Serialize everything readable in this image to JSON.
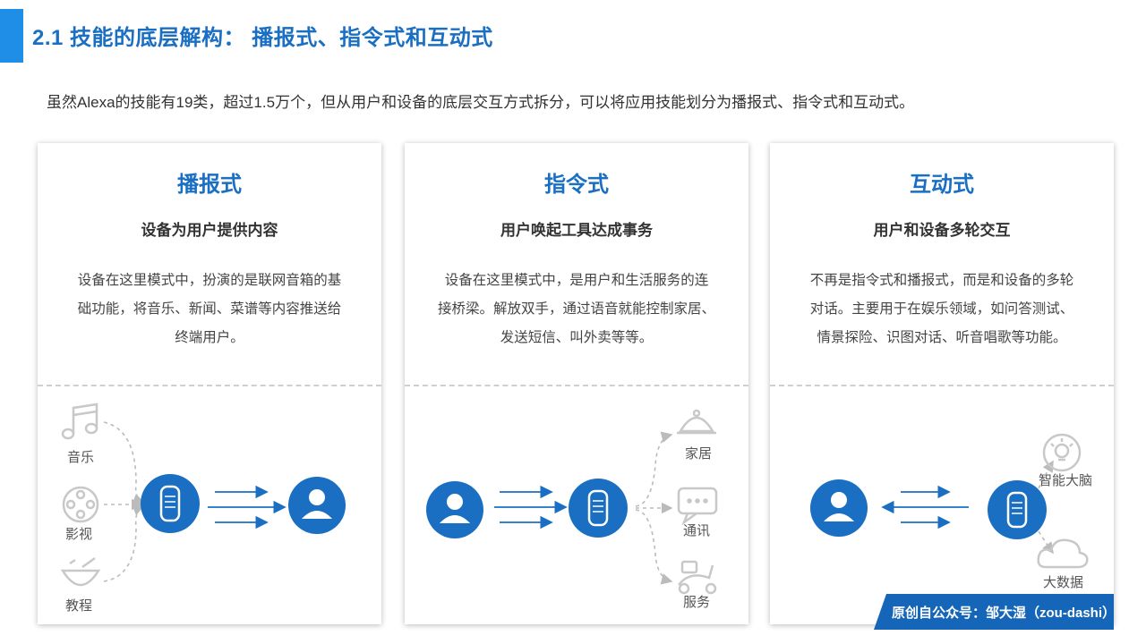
{
  "header": {
    "title": "2.1 技能的底层解构： 播报式、指令式和互动式",
    "intro": "虽然Alexa的技能有19类，超过1.5万个，但从用户和设备的底层交互方式拆分，可以将应用技能划分为播报式、指令式和互动式。"
  },
  "cards": [
    {
      "title": "播报式",
      "subtitle": "设备为用户提供内容",
      "desc_lines": [
        "设备在这里模式中，扮演的是联网音箱的基",
        "础功能，将音乐、新闻、菜谱等内容推送给",
        "终端用户。"
      ],
      "items": [
        {
          "label": "音乐",
          "icon": "music-note-icon"
        },
        {
          "label": "影视",
          "icon": "film-reel-icon"
        },
        {
          "label": "教程",
          "icon": "cooking-bowl-icon"
        }
      ]
    },
    {
      "title": "指令式",
      "subtitle": "用户唤起工具达成事务",
      "desc_lines": [
        "设备在这里模式中，是用户和生活服务的连",
        "接桥梁。解放双手，通过语音就能控制家居、",
        "发送短信、叫外卖等等。"
      ],
      "items": [
        {
          "label": "家居",
          "icon": "cloche-icon"
        },
        {
          "label": "通讯",
          "icon": "chat-bubble-icon"
        },
        {
          "label": "服务",
          "icon": "scooter-icon"
        }
      ]
    },
    {
      "title": "互动式",
      "subtitle": "用户和设备多轮交互",
      "desc_lines": [
        "不再是指令式和播报式，而是和设备的多轮",
        "对话。主要用于在娱乐领域，如问答测试、",
        "情景探险、识图对话、听音唱歌等功能。"
      ],
      "items": [
        {
          "label": "智能大脑",
          "icon": "lightbulb-icon"
        },
        {
          "label": "大数据",
          "icon": "cloud-icon"
        }
      ]
    }
  ],
  "footer": {
    "badge": "原创自公众号：邹大湿（zou-dashi）"
  },
  "colors": {
    "accent": "#1a6fc2",
    "node": "#1a6fc2",
    "icon_gray": "#c8c8c8"
  }
}
